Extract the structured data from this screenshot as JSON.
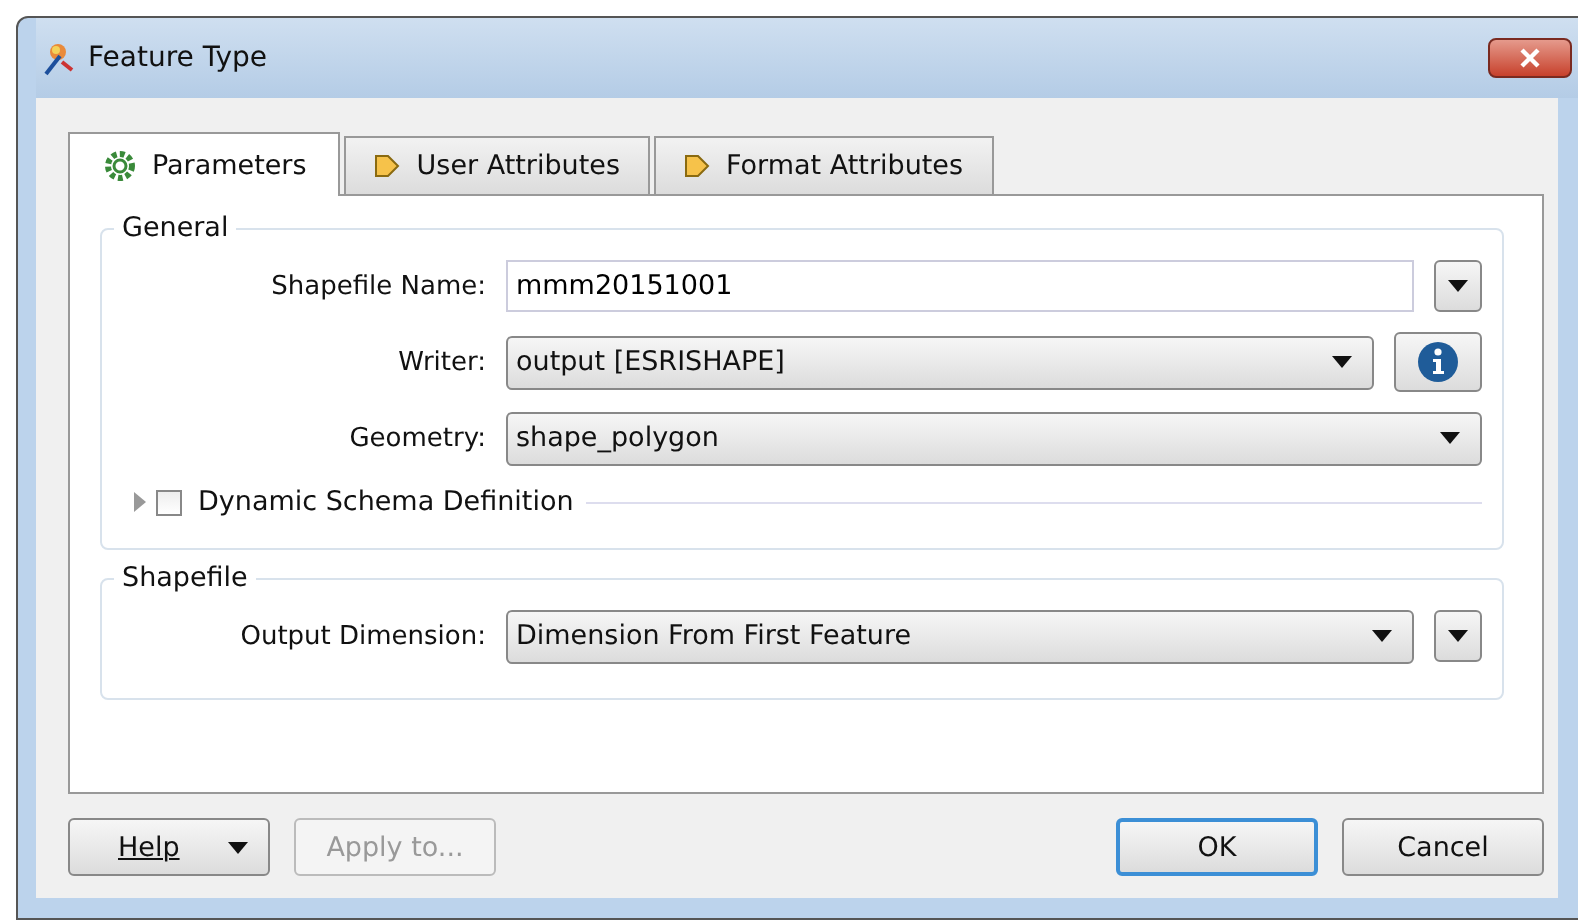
{
  "window": {
    "title": "Feature Type"
  },
  "tabs": [
    {
      "label": "Parameters",
      "kind": "gear",
      "selected": true
    },
    {
      "label": "User Attributes",
      "kind": "arrow",
      "selected": false
    },
    {
      "label": "Format Attributes",
      "kind": "arrow",
      "selected": false
    }
  ],
  "general": {
    "title": "General",
    "fields": [
      {
        "label": "Shapefile Name:",
        "kind": "text",
        "value": "mmm20151001",
        "accessory": {
          "kind": "menu"
        }
      },
      {
        "label": "Writer:",
        "kind": "select",
        "value": "output [ESRISHAPE]",
        "accessory": {
          "kind": "info"
        }
      },
      {
        "label": "Geometry:",
        "kind": "select",
        "value": "shape_polygon"
      }
    ],
    "schema": {
      "label": "Dynamic Schema Definition",
      "expanded": false,
      "checked": false
    }
  },
  "shapefile": {
    "title": "Shapefile",
    "fields": [
      {
        "label": "Output Dimension:",
        "kind": "select",
        "value": "Dimension From First Feature",
        "accessory": {
          "kind": "menu"
        }
      }
    ]
  },
  "buttons": [
    {
      "label": "Help",
      "kind": "menu",
      "underline_first": true,
      "disabled": false,
      "default": false
    },
    {
      "label": "Apply to...",
      "kind": "plain",
      "underline_first": false,
      "disabled": true,
      "default": false
    },
    {
      "label": "OK",
      "kind": "plain",
      "underline_first": false,
      "disabled": false,
      "default": true
    },
    {
      "label": "Cancel",
      "kind": "plain",
      "underline_first": false,
      "disabled": false,
      "default": false
    }
  ]
}
